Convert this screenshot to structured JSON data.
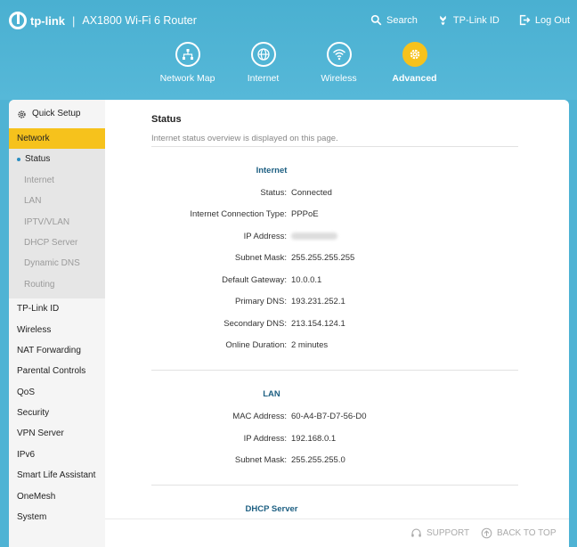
{
  "header": {
    "brand": "tp-link",
    "separator": "|",
    "model": "AX1800 Wi-Fi 6 Router",
    "actions": [
      {
        "label": "Search",
        "icon": "search-icon"
      },
      {
        "label": "TP-Link ID",
        "icon": "tplink-id-icon"
      },
      {
        "label": "Log Out",
        "icon": "logout-icon"
      }
    ]
  },
  "nav": [
    {
      "label": "Network Map",
      "icon": "network-map-icon",
      "active": false
    },
    {
      "label": "Internet",
      "icon": "globe-icon",
      "active": false
    },
    {
      "label": "Wireless",
      "icon": "wifi-icon",
      "active": false
    },
    {
      "label": "Advanced",
      "icon": "gear-icon",
      "active": true
    }
  ],
  "sidebar": {
    "quick_setup": "Quick Setup",
    "network": "Network",
    "network_sub": [
      "Status",
      "Internet",
      "LAN",
      "IPTV/VLAN",
      "DHCP Server",
      "Dynamic DNS",
      "Routing"
    ],
    "items": [
      "TP-Link ID",
      "Wireless",
      "NAT Forwarding",
      "Parental Controls",
      "QoS",
      "Security",
      "VPN Server",
      "IPv6",
      "Smart Life Assistant",
      "OneMesh",
      "System"
    ]
  },
  "content": {
    "title": "Status",
    "subtitle": "Internet status overview is displayed on this page.",
    "internet": {
      "title": "Internet",
      "rows": [
        {
          "label": "Status:",
          "value": "Connected"
        },
        {
          "label": "Internet Connection Type:",
          "value": "PPPoE"
        },
        {
          "label": "IP Address:",
          "value": ""
        },
        {
          "label": "Subnet Mask:",
          "value": "255.255.255.255"
        },
        {
          "label": "Default Gateway:",
          "value": "10.0.0.1"
        },
        {
          "label": "Primary DNS:",
          "value": "193.231.252.1"
        },
        {
          "label": "Secondary DNS:",
          "value": "213.154.124.1"
        },
        {
          "label": "Online Duration:",
          "value": "2 minutes"
        }
      ]
    },
    "lan": {
      "title": "LAN",
      "rows": [
        {
          "label": "MAC Address:",
          "value": "60-A4-B7-D7-56-D0"
        },
        {
          "label": "IP Address:",
          "value": "192.168.0.1"
        },
        {
          "label": "Subnet Mask:",
          "value": "255.255.255.0"
        }
      ]
    },
    "dhcp": {
      "title": "DHCP Server"
    }
  },
  "footer": {
    "support": "SUPPORT",
    "back_to_top": "BACK TO TOP"
  },
  "colors": {
    "accent": "#f6c21c",
    "header": "#4fb3d4",
    "section_title": "#1d5f82"
  }
}
